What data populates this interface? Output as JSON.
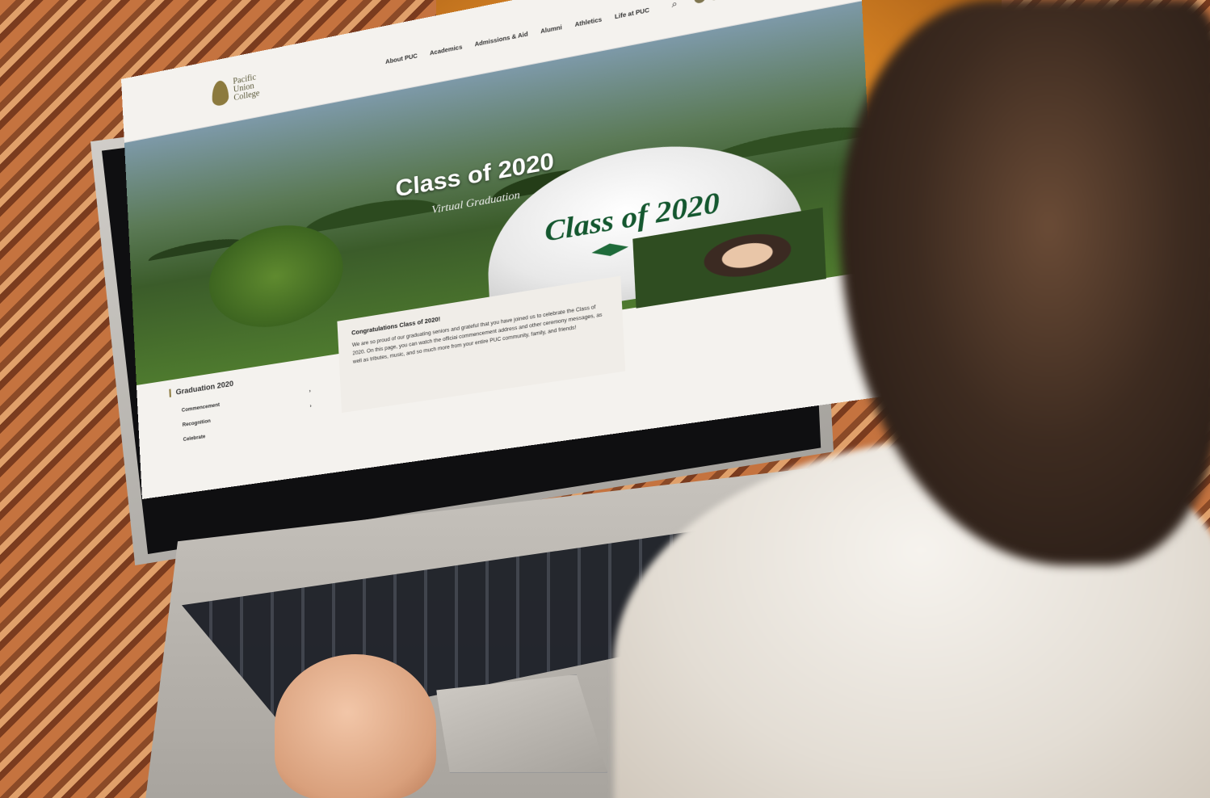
{
  "site": {
    "logo_text": "Pacific Union College",
    "nav": [
      "About PUC",
      "Academics",
      "Admissions & Aid",
      "Alumni",
      "Athletics",
      "Life at PUC"
    ],
    "search_icon": "search-icon",
    "social_icons": [
      "facebook-icon",
      "twitter-icon",
      "instagram-icon",
      "youtube-icon",
      "email-icon"
    ]
  },
  "hero": {
    "title": "Class of 2020",
    "subtitle": "Virtual Graduation",
    "rock_text": "Class of 2020"
  },
  "sidebar": {
    "title": "Graduation 2020",
    "items": [
      {
        "label": "Commencement"
      },
      {
        "label": "Recognition"
      },
      {
        "label": "Celebrate"
      }
    ]
  },
  "content": {
    "heading": "Congratulations Class of 2020!",
    "paragraph": "We are so proud of our graduating seniors and grateful that you have joined us to celebrate the Class of 2020. On this page, you can watch the official commencement address and other ceremony messages, as well as tributes, music, and so much more from your entire PUC community, family, and friends!"
  }
}
